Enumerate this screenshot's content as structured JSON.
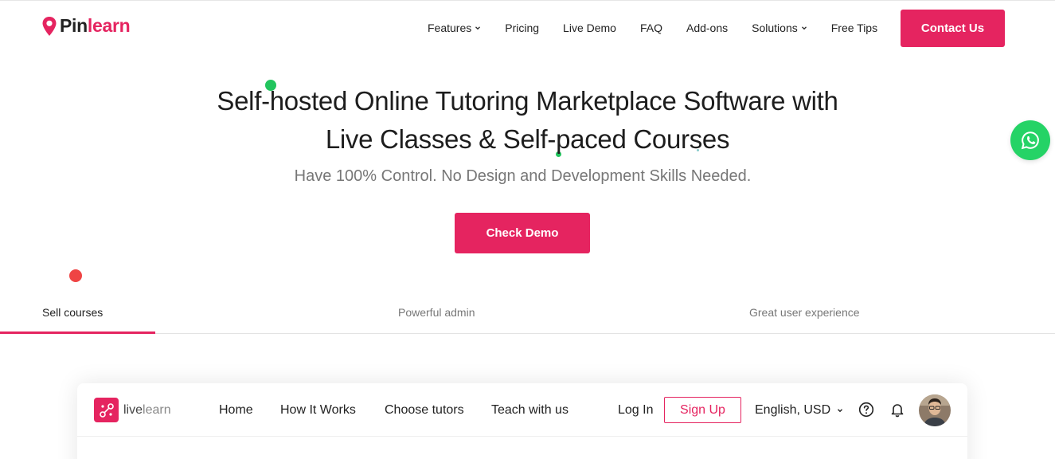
{
  "brand": {
    "name_dark": "Pin",
    "name_accent": "learn",
    "accent_color": "#e52460"
  },
  "nav": {
    "items": [
      {
        "label": "Features",
        "dropdown": true
      },
      {
        "label": "Pricing",
        "dropdown": false
      },
      {
        "label": "Live Demo",
        "dropdown": false
      },
      {
        "label": "FAQ",
        "dropdown": false
      },
      {
        "label": "Add-ons",
        "dropdown": false
      },
      {
        "label": "Solutions",
        "dropdown": true
      },
      {
        "label": "Free Tips",
        "dropdown": false
      }
    ],
    "contact_label": "Contact Us"
  },
  "hero": {
    "title_line1": "Self-hosted Online Tutoring Marketplace Software with",
    "title_line2": "Live Classes & Self-paced Courses",
    "subtitle": "Have 100% Control. No Design and Development Skills Needed.",
    "cta_label": "Check Demo"
  },
  "floating": {
    "whatsapp_icon": "whatsapp-icon",
    "whatsapp_color": "#25d366"
  },
  "tabs": [
    {
      "label": "Sell courses",
      "active": true
    },
    {
      "label": "Powerful admin",
      "active": false
    },
    {
      "label": "Great user experience",
      "active": false
    }
  ],
  "preview": {
    "logo_light": "live",
    "logo_rest": "learn",
    "nav": [
      "Home",
      "How It Works",
      "Choose tutors",
      "Teach with us"
    ],
    "login_label": "Log In",
    "signup_label": "Sign Up",
    "locale_label": "English, USD",
    "help_icon": "help-circle-icon",
    "bell_icon": "bell-icon",
    "avatar_icon": "user-avatar"
  }
}
